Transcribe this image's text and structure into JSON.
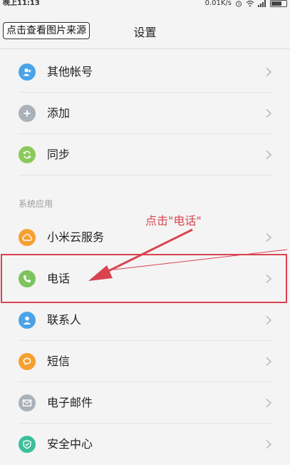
{
  "status_bar": {
    "time": "晚上11:13",
    "network_speed": "0.01K/s"
  },
  "header": {
    "source_button_label": "点击查看图片来源",
    "title": "设置"
  },
  "section_label": "系统应用",
  "annotation_text": "点击\"电话\"",
  "items": [
    {
      "label": "其他帐号",
      "icon": "other-accounts-icon",
      "color": "#4aa3e8"
    },
    {
      "label": "添加",
      "icon": "add-icon",
      "color": "#aab1b9"
    },
    {
      "label": "同步",
      "icon": "sync-icon",
      "color": "#8cc95b"
    },
    {
      "label": "小米云服务",
      "icon": "cloud-icon",
      "color": "#f5a032"
    },
    {
      "label": "电话",
      "icon": "phone-icon",
      "color": "#7cc460"
    },
    {
      "label": "联系人",
      "icon": "contacts-icon",
      "color": "#4aa3e8"
    },
    {
      "label": "短信",
      "icon": "message-icon",
      "color": "#f5a032"
    },
    {
      "label": "电子邮件",
      "icon": "mail-icon",
      "color": "#aab1b9"
    },
    {
      "label": "安全中心",
      "icon": "security-icon",
      "color": "#3cbf9a"
    }
  ],
  "highlight_color": "#d9434f"
}
